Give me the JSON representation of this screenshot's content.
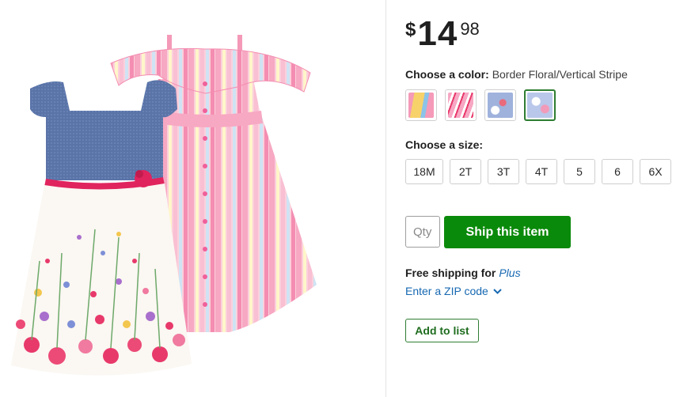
{
  "product": {
    "image_alt": "Two girls' dresses: chambray top with floral border skirt and pink vertical stripe button-front dress"
  },
  "price": {
    "currency": "$",
    "dollars": "14",
    "cents": "98"
  },
  "color": {
    "label": "Choose a color:",
    "selected": "Border Floral/Vertical Stripe",
    "swatches": [
      {
        "icon": "yellow-floral-swatch",
        "colors": [
          "#f7d26a",
          "#f59ab8",
          "#8cc3e8"
        ]
      },
      {
        "icon": "pink-floral-swatch",
        "colors": [
          "#f7a7c3",
          "#ffffff",
          "#e8396b"
        ]
      },
      {
        "icon": "blue-floral-swatch",
        "colors": [
          "#9fb2dc",
          "#ffffff",
          "#e86a7b"
        ]
      },
      {
        "icon": "border-floral-vertical-stripe-swatch",
        "colors": [
          "#b9c7ea",
          "#ffffff",
          "#f29ab9"
        ]
      }
    ]
  },
  "size": {
    "label": "Choose a size:",
    "options": [
      "18M",
      "2T",
      "3T",
      "4T",
      "5",
      "6",
      "6X"
    ]
  },
  "purchase": {
    "qty_placeholder": "Qty",
    "ship_label": "Ship this item"
  },
  "shipping": {
    "free_text": "Free shipping for",
    "plus_text": "Plus",
    "zip_link": "Enter a ZIP code"
  },
  "list": {
    "add_label": "Add to list"
  },
  "colors": {
    "accent_green": "#0a8a0a",
    "link_blue": "#1668b2"
  }
}
